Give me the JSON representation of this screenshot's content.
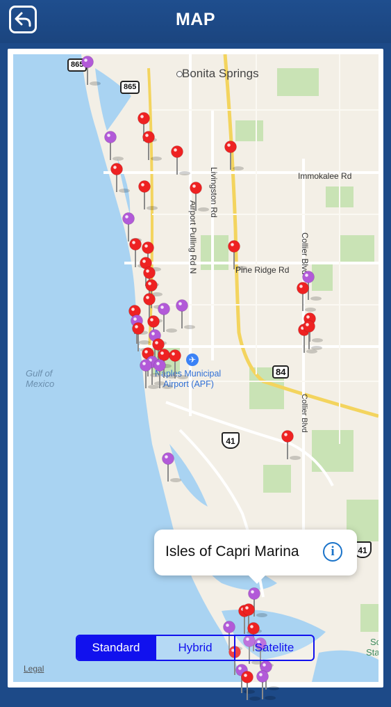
{
  "header": {
    "title": "MAP",
    "back_icon": "back-arrow-icon"
  },
  "map": {
    "places": {
      "bonita_springs": "Bonita Springs"
    },
    "roads": {
      "immokalee": "Immokalee Rd",
      "livingston": "Livingston Rd",
      "airport_pulling": "Airport Pulling Rd N",
      "pine_ridge": "Pine Ridge Rd",
      "collier_blvd_top": "Collier Blvd",
      "collier_blvd_bottom": "Collier Blvd"
    },
    "water": {
      "gulf_line1": "Gulf of",
      "gulf_line2": "Mexico"
    },
    "shields": {
      "s865a": "865",
      "s865b": "865",
      "s84": "84",
      "s41": "41",
      "s41b": "41",
      "partial1": "Sc",
      "partial2": "Sta"
    },
    "airport": {
      "line1": "Naples Municipal",
      "line2": "Airport (APF)"
    },
    "legal": "Legal",
    "pin_colors": {
      "red": "#ee2222",
      "purple": "#b25ad8"
    }
  },
  "callout": {
    "title": "Isles of Capri Marina",
    "info_icon": "info-icon"
  },
  "map_type": {
    "options": [
      "Standard",
      "Hybrid",
      "Satelite"
    ],
    "selected": "Standard"
  }
}
